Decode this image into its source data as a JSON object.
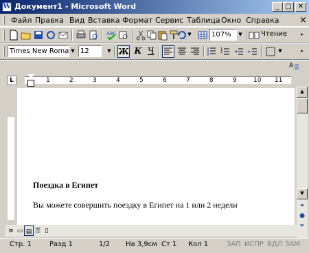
{
  "window": {
    "title": "Документ1 - Microsoft Word",
    "min": "_",
    "max": "□",
    "close": "✕"
  },
  "menu": {
    "items": [
      "Файл",
      "Правка",
      "Вид",
      "Вставка",
      "Формат",
      "Сервис",
      "Таблица",
      "Окно",
      "Справка"
    ],
    "close": "×"
  },
  "standard_toolbar": {
    "zoom": "107%",
    "reading_label": "Чтение"
  },
  "format_toolbar": {
    "font": "Times New Roman",
    "size": "12",
    "bold": "Ж",
    "italic": "К",
    "underline": "Ч"
  },
  "ruler": {
    "marks": [
      "1",
      "2",
      "3",
      "4",
      "5",
      "6",
      "7",
      "8",
      "9",
      "10",
      "11"
    ]
  },
  "document": {
    "heading": "Поездка в Египет",
    "body": "Вы можете совершить поездку в Египет на 1 или 2 недели"
  },
  "status": {
    "page": "Стр. 1",
    "section": "Разд 1",
    "pages": "1/2",
    "at": "На 3,9см",
    "line": "Ст 1",
    "col": "Кол 1",
    "rec": "ЗАП",
    "trk": "ИСПР",
    "ext": "ВДЛ",
    "ovr": "ЗАМ"
  }
}
